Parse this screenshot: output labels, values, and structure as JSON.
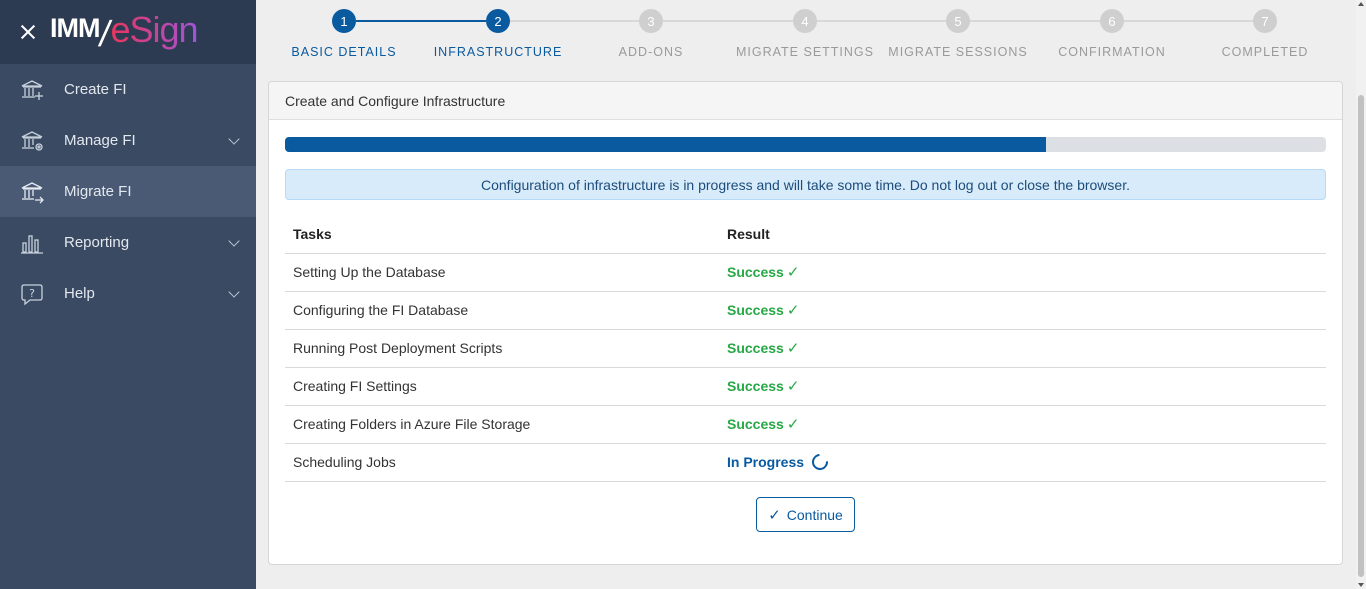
{
  "brand": {
    "imm": "IMM",
    "slash": "/",
    "esign": "eSign"
  },
  "sidebar": {
    "items": [
      {
        "label": "Create FI",
        "icon": "bank-add-icon",
        "active": false,
        "expandable": false
      },
      {
        "label": "Manage FI",
        "icon": "bank-gear-icon",
        "active": false,
        "expandable": true
      },
      {
        "label": "Migrate FI",
        "icon": "bank-arrow-icon",
        "active": true,
        "expandable": false
      },
      {
        "label": "Reporting",
        "icon": "bar-chart-icon",
        "active": false,
        "expandable": true
      },
      {
        "label": "Help",
        "icon": "help-bubble-icon",
        "active": false,
        "expandable": true
      }
    ]
  },
  "stepper": {
    "steps": [
      {
        "num": "1",
        "label": "BASIC DETAILS",
        "state": "done"
      },
      {
        "num": "2",
        "label": "INFRASTRUCTURE",
        "state": "done"
      },
      {
        "num": "3",
        "label": "ADD-ONS",
        "state": "todo"
      },
      {
        "num": "4",
        "label": "MIGRATE SETTINGS",
        "state": "todo"
      },
      {
        "num": "5",
        "label": "MIGRATE SESSIONS",
        "state": "todo"
      },
      {
        "num": "6",
        "label": "CONFIRMATION",
        "state": "todo"
      },
      {
        "num": "7",
        "label": "COMPLETED",
        "state": "todo"
      }
    ]
  },
  "card": {
    "title": "Create and Configure Infrastructure",
    "progress_fraction": 0.731,
    "alert": "Configuration of infrastructure is in progress and will take some time. Do not log out or close the browser.",
    "table": {
      "headers": [
        "Tasks",
        "Result"
      ],
      "rows": [
        {
          "task": "Setting Up the Database",
          "result": "Success",
          "status": "success"
        },
        {
          "task": "Configuring the FI Database",
          "result": "Success",
          "status": "success"
        },
        {
          "task": "Running Post Deployment Scripts",
          "result": "Success",
          "status": "success"
        },
        {
          "task": "Creating FI Settings",
          "result": "Success",
          "status": "success"
        },
        {
          "task": "Creating Folders in Azure File Storage",
          "result": "Success",
          "status": "success"
        },
        {
          "task": "Scheduling Jobs",
          "result": "In Progress",
          "status": "progress"
        }
      ]
    },
    "continue_label": "Continue"
  },
  "colors": {
    "primary": "#0a5aa0",
    "success": "#27a745",
    "sidebar": "#3a4a63"
  }
}
